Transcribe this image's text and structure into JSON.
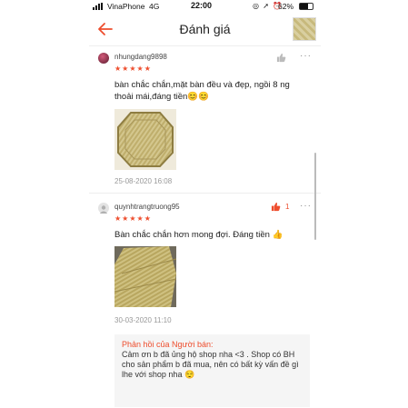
{
  "status_bar": {
    "carrier": "VinaPhone",
    "network": "4G",
    "time": "22:00",
    "battery": "62%",
    "battery_level": 0.62
  },
  "header": {
    "title": "Đánh giá",
    "back_icon": "back-arrow-icon",
    "accent": "#ee4d2d"
  },
  "reviews": [
    {
      "username": "nhungdang9898",
      "rating": 5,
      "stars": "★★★★★",
      "text": "bàn chắc chắn,mặt bàn đều và đẹp, ngồi 8 ng thoải mái,đáng tiền😊😊",
      "date": "25-08-2020 16:08",
      "likes": ""
    },
    {
      "username": "quynhtrangtruong95",
      "rating": 5,
      "stars": "★★★★★",
      "text": "Bàn chắc chắn hơn mong đợi. Đáng tiền 👍",
      "date": "30-03-2020 11:10",
      "likes": "1"
    }
  ],
  "seller_reply": {
    "label": "Phản hồi của Người bán:",
    "text": "Cảm ơn b đã ủng hộ shop nha <3 . Shop có BH cho sản phẩm b đã mua, nên có bất kỳ vấn đề gì lhe với shop nha 😌"
  },
  "more_label": "···"
}
